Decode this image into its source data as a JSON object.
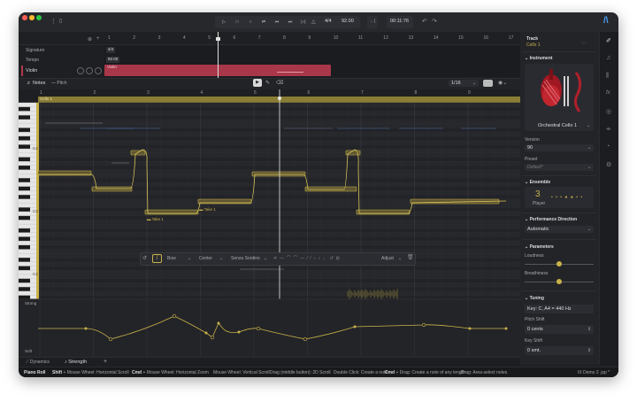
{
  "titlebar": {
    "time_signature": "4/4",
    "tempo": "92.00",
    "time_display": "00:11:76"
  },
  "ruler_top": [
    "1",
    "2",
    "3",
    "4",
    "5",
    "6",
    "7",
    "8",
    "9",
    "10",
    "11",
    "12",
    "13",
    "14",
    "15",
    "16",
    "17"
  ],
  "tracks": {
    "signature_label": "Signature",
    "signature_value": "4/4",
    "tempo_label": "Tempo",
    "tempo_value": "92.00",
    "violin_label": "Violin",
    "violin_clip": "Violin"
  },
  "editor_tabs": {
    "notes": "Notes",
    "pitch": "Pitch"
  },
  "quantize": "1/16",
  "ruler_editor": [
    "1",
    "2",
    "3",
    "4",
    "5",
    "6",
    "7",
    "8",
    "9"
  ],
  "clip_name": "Cello 1",
  "piano_labels": [
    "C4",
    "C3",
    "C2"
  ],
  "take_labels": [
    "Take 1",
    "Take 1"
  ],
  "toolbar": {
    "mode": "Bow",
    "position": "Center",
    "technique": "Senza Sordino",
    "adjust": "Adjust"
  },
  "lane": {
    "top_label": "Strong",
    "bottom_label": "Soft"
  },
  "bottom_tabs": {
    "dynamics": "Dynamics",
    "strength": "Strength"
  },
  "panel": {
    "track_title": "Track",
    "track_name": "Cello 1",
    "instrument_title": "Instrument",
    "instrument_name": "Orchestral Cello 1",
    "version_label": "Version",
    "version_value": "90",
    "preset_label": "Preset",
    "preset_value": "Default*",
    "ensemble_title": "Ensemble",
    "player_count": "3",
    "player_label": "Player",
    "performance_title": "Performance Direction",
    "performance_value": "Automatic",
    "parameters_title": "Parameters",
    "loudness_label": "Loudness",
    "loudness_value": 0.5,
    "breathiness_label": "Breathiness",
    "breathiness_value": 0.5,
    "tuning_title": "Tuning",
    "tuning_value": "Key: C, A4 = 440 Hz",
    "pitch_shift_label": "Pitch Shift",
    "pitch_shift_value": "0 cents",
    "key_shift_label": "Key Shift",
    "key_shift_value": "0 smt."
  },
  "statusbar": {
    "mode": "Piano Roll",
    "hints": [
      {
        "key": "Shift",
        "text": "+ Mouse Wheel: Horizontal Scroll"
      },
      {
        "key": "Cmd",
        "text": "+ Mouse Wheel: Horizontal Zoom"
      },
      {
        "key": "",
        "text": "Mouse Wheel: Vertical Scroll"
      },
      {
        "key": "",
        "text": "Drag (middle button): 2D Scroll"
      },
      {
        "key": "",
        "text": "Double Click: Create a note"
      },
      {
        "key": "Cmd",
        "text": "+ Drag: Create a note of any length"
      },
      {
        "key": "",
        "text": "Drag: Area-select notes"
      }
    ],
    "project": "IX Demo 2 .jsp *"
  },
  "colors": {
    "accent_yellow": "#c9b34a",
    "track_red": "#b0374b",
    "panel_bg": "#232428",
    "editor_bg": "#26272b"
  },
  "icons": [
    "menu-icon",
    "file-icon",
    "play-icon",
    "stop-icon",
    "record-icon",
    "loop-icon",
    "rewind-icon",
    "forward-icon",
    "metronome-icon",
    "undo-icon",
    "redo-icon",
    "select-tool-icon",
    "pencil-tool-icon",
    "eraser-tool-icon",
    "settings-icon",
    "mixer-icon",
    "music-note-icon",
    "fx-icon",
    "eye-icon",
    "gear-icon"
  ]
}
